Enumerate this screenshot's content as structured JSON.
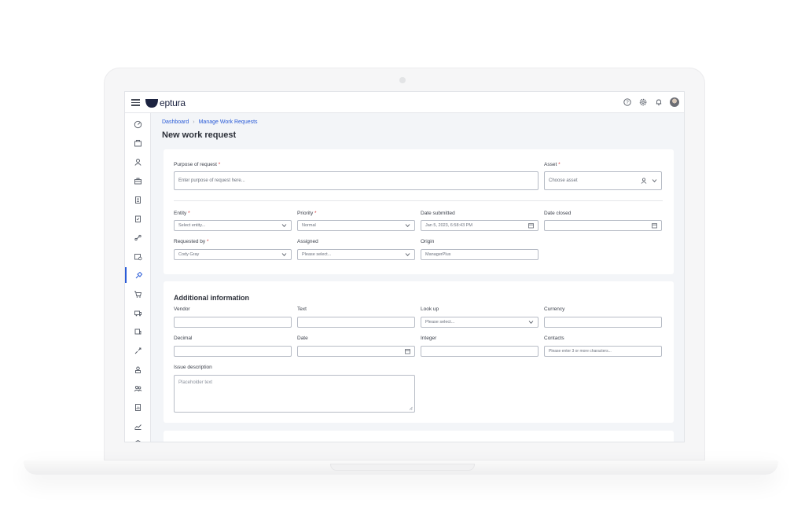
{
  "app": {
    "brand": "eptura"
  },
  "breadcrumb": {
    "items": [
      "Dashboard",
      "Manage Work Requests"
    ],
    "separator": "›"
  },
  "page": {
    "title": "New work request"
  },
  "request": {
    "purpose": {
      "label": "Purpose of request",
      "placeholder": "Enter purpose of request here..."
    },
    "asset": {
      "label": "Asset",
      "placeholder": "Choose asset"
    },
    "entity": {
      "label": "Entity",
      "placeholder": "Select entity..."
    },
    "priority": {
      "label": "Priority",
      "value": "Normal"
    },
    "date_submitted": {
      "label": "Date submitted",
      "value": "Jan 5, 2023, 6:58:43 PM"
    },
    "date_closed": {
      "label": "Date closed",
      "value": ""
    },
    "requested_by": {
      "label": "Requested by",
      "value": "Cody Gray"
    },
    "assigned": {
      "label": "Assigned",
      "placeholder": "Please select..."
    },
    "origin": {
      "label": "Origin",
      "value": "ManagerPlus"
    },
    "required_mark": "*"
  },
  "additional": {
    "title": "Additional information",
    "vendor": {
      "label": "Vendor",
      "value": ""
    },
    "text": {
      "label": "Text",
      "value": ""
    },
    "lookup": {
      "label": "Look up",
      "placeholder": "Please select..."
    },
    "currency": {
      "label": "Currency",
      "value": ""
    },
    "decimal": {
      "label": "Decimal",
      "value": ""
    },
    "date": {
      "label": "Date",
      "value": ""
    },
    "integer": {
      "label": "Integer",
      "value": ""
    },
    "contacts": {
      "label": "Contacts",
      "placeholder": "Please enter 3 or more characters..."
    },
    "issue_description": {
      "label": "Issue description",
      "placeholder": "Placeholder text"
    }
  },
  "colors": {
    "accent": "#2a5bd7",
    "required": "#d23a3a",
    "page_bg": "#f3f5f8"
  },
  "icons": {
    "top": [
      "help-icon",
      "settings-icon",
      "bell-icon",
      "avatar"
    ],
    "sidebar": [
      "dashboard-icon",
      "locations-icon",
      "people-icon",
      "assets-icon",
      "documents-icon",
      "checklist-icon",
      "routes-icon",
      "calendar-icon",
      "work-requests-icon",
      "purchasing-icon",
      "fleet-icon",
      "vehicle-icon",
      "tools-icon",
      "user-icon",
      "teams-icon",
      "reports-icon",
      "analytics-icon",
      "admin-icon"
    ]
  }
}
